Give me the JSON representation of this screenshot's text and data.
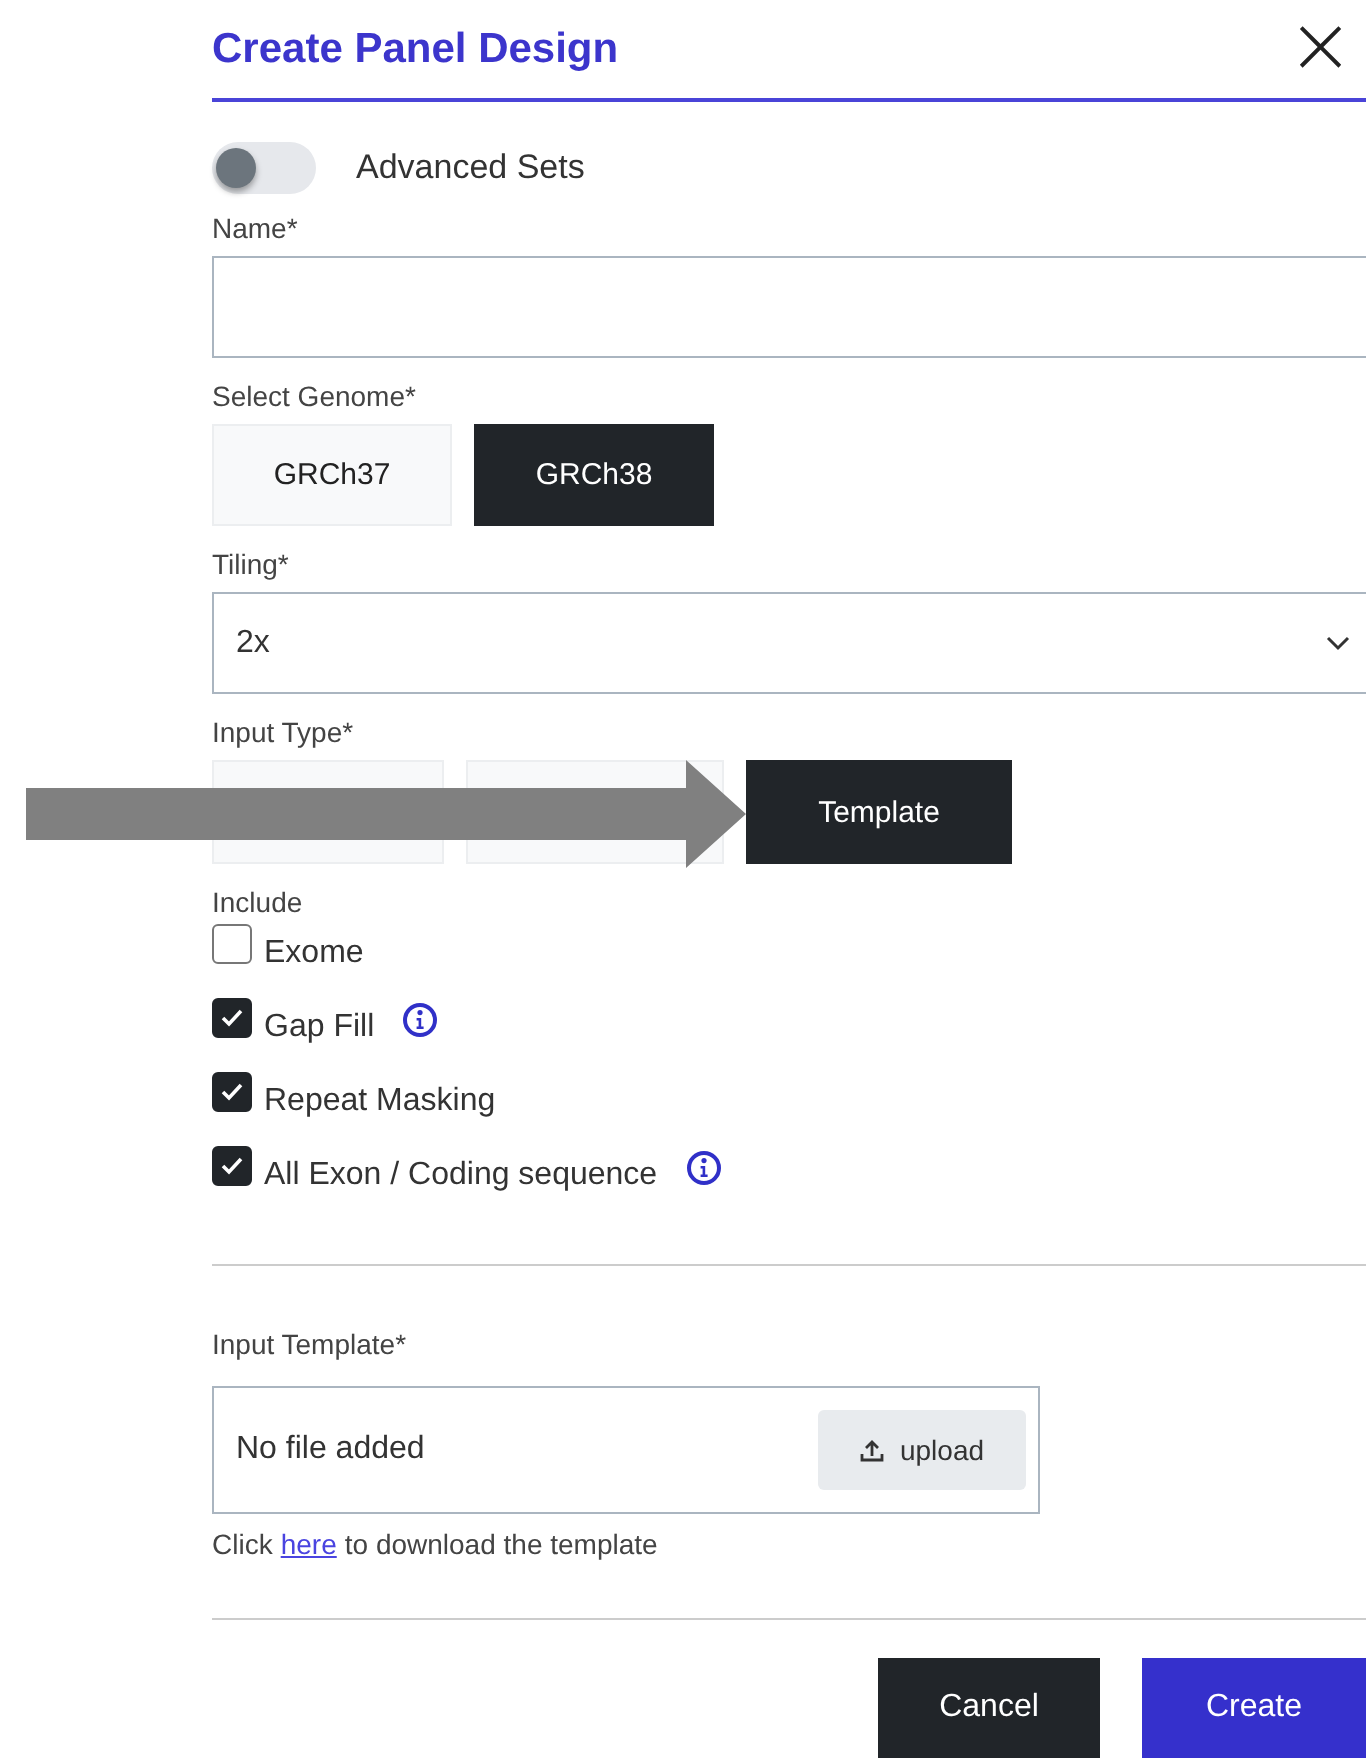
{
  "dialog": {
    "title": "Create Panel Design",
    "close": "×"
  },
  "advanced_sets": {
    "label": "Advanced Sets",
    "on": false
  },
  "name_field": {
    "label": "Name*"
  },
  "genome": {
    "label": "Select Genome*",
    "options": [
      {
        "label": "GRCh37",
        "selected": false
      },
      {
        "label": "GRCh38",
        "selected": true
      }
    ]
  },
  "tiling": {
    "label": "Tiling*",
    "value": "2x"
  },
  "input_type": {
    "label": "Input Type*",
    "options": [
      {
        "selected": false
      },
      {
        "selected": false
      },
      {
        "label": "Template",
        "selected": true
      }
    ]
  },
  "include": {
    "label": "Include",
    "items": [
      {
        "label": "Exome",
        "checked": false,
        "info": false
      },
      {
        "label": "Gap Fill",
        "checked": true,
        "info": true
      },
      {
        "label": "Repeat Masking",
        "checked": true,
        "info": false
      },
      {
        "label": "All Exon / Coding sequence",
        "checked": true,
        "info": true
      }
    ]
  },
  "input_template": {
    "label": "Input Template*",
    "file_status": "No file added",
    "upload_button": "upload",
    "hint_before": "Click",
    "hint_link": "here",
    "hint_after": "to download the template"
  },
  "buttons": [
    {
      "label": "Cancel",
      "kind": "secondary"
    },
    {
      "label": "Create",
      "kind": "primary"
    }
  ]
}
